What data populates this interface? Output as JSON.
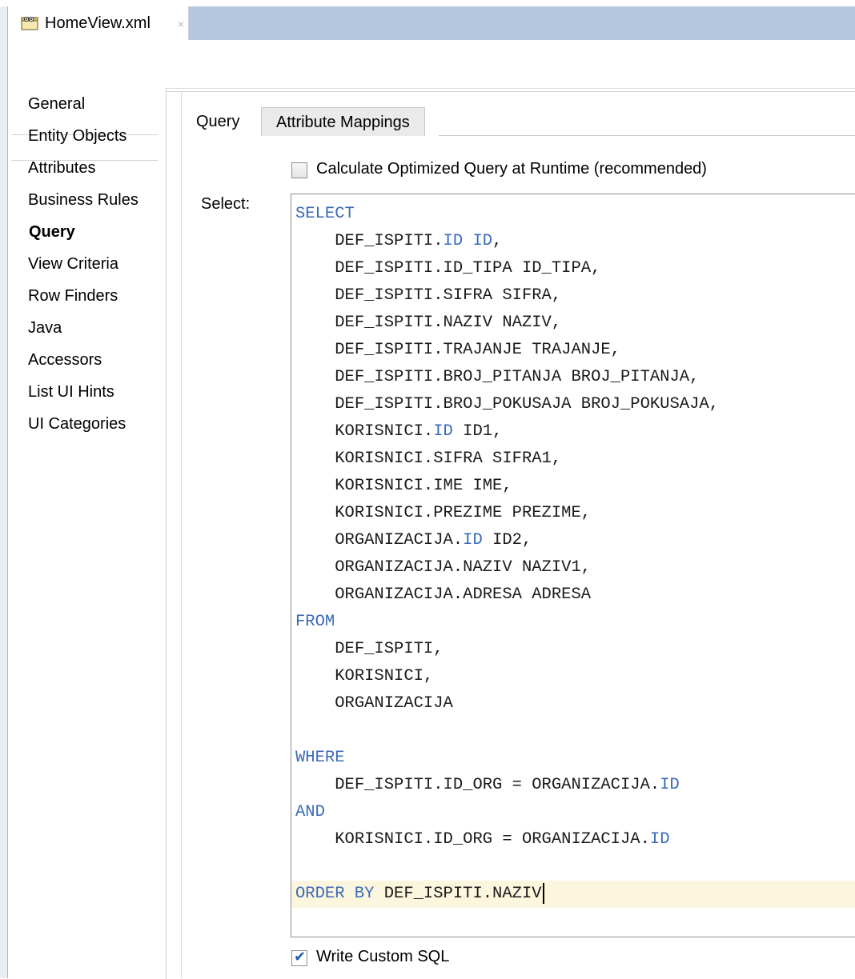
{
  "editor": {
    "file_tab": "HomeView.xml",
    "close_glyph": "×",
    "file_icon": "view-object-icon"
  },
  "sidebar": {
    "items": [
      {
        "label": "General"
      },
      {
        "label": "Entity Objects"
      },
      {
        "label": "Attributes"
      },
      {
        "label": "Business Rules"
      },
      {
        "label": "Query",
        "selected": true
      },
      {
        "label": "View Criteria"
      },
      {
        "label": "Row Finders"
      },
      {
        "label": "Java"
      },
      {
        "label": "Accessors"
      },
      {
        "label": "List UI Hints"
      },
      {
        "label": "UI Categories"
      }
    ]
  },
  "main": {
    "tabs": [
      {
        "label": "Query",
        "active": true
      },
      {
        "label": "Attribute Mappings",
        "active": false
      }
    ],
    "optimize_checkbox": {
      "label": "Calculate Optimized Query at Runtime (recommended)",
      "checked": false
    },
    "select_label": "Select:",
    "custom_sql_checkbox": {
      "label": "Write Custom SQL",
      "checked": true
    },
    "check_glyph": "✔"
  },
  "sql": {
    "lines": [
      {
        "keyword": "SELECT"
      },
      {
        "indent": "    ",
        "parts": [
          "DEF_ISPITI.",
          {
            "kw": "ID"
          },
          " ",
          {
            "kw": "ID"
          },
          ","
        ]
      },
      {
        "indent": "    ",
        "parts": [
          "DEF_ISPITI.ID_TIPA ID_TIPA,"
        ]
      },
      {
        "indent": "    ",
        "parts": [
          "DEF_ISPITI.SIFRA SIFRA,"
        ]
      },
      {
        "indent": "    ",
        "parts": [
          "DEF_ISPITI.NAZIV NAZIV,"
        ]
      },
      {
        "indent": "    ",
        "parts": [
          "DEF_ISPITI.TRAJANJE TRAJANJE,"
        ]
      },
      {
        "indent": "    ",
        "parts": [
          "DEF_ISPITI.BROJ_PITANJA BROJ_PITANJA,"
        ]
      },
      {
        "indent": "    ",
        "parts": [
          "DEF_ISPITI.BROJ_POKUSAJA BROJ_POKUSAJA,"
        ]
      },
      {
        "indent": "    ",
        "parts": [
          "KORISNICI.",
          {
            "kw": "ID"
          },
          " ID1,"
        ]
      },
      {
        "indent": "    ",
        "parts": [
          "KORISNICI.SIFRA SIFRA1,"
        ]
      },
      {
        "indent": "    ",
        "parts": [
          "KORISNICI.IME IME,"
        ]
      },
      {
        "indent": "    ",
        "parts": [
          "KORISNICI.PREZIME PREZIME,"
        ]
      },
      {
        "indent": "    ",
        "parts": [
          "ORGANIZACIJA.",
          {
            "kw": "ID"
          },
          " ID2,"
        ]
      },
      {
        "indent": "    ",
        "parts": [
          "ORGANIZACIJA.NAZIV NAZIV1,"
        ]
      },
      {
        "indent": "    ",
        "parts": [
          "ORGANIZACIJA.ADRESA ADRESA"
        ]
      },
      {
        "keyword": "FROM"
      },
      {
        "indent": "    ",
        "parts": [
          "DEF_ISPITI,"
        ]
      },
      {
        "indent": "    ",
        "parts": [
          "KORISNICI,"
        ]
      },
      {
        "indent": "    ",
        "parts": [
          "ORGANIZACIJA"
        ]
      },
      {
        "blank": true
      },
      {
        "keyword": "WHERE"
      },
      {
        "indent": "    ",
        "parts": [
          "DEF_ISPITI.ID_ORG = ORGANIZACIJA.",
          {
            "kw": "ID"
          }
        ]
      },
      {
        "keyword": "AND"
      },
      {
        "indent": "    ",
        "parts": [
          "KORISNICI.ID_ORG = ORGANIZACIJA.",
          {
            "kw": "ID"
          }
        ]
      },
      {
        "blank": true
      },
      {
        "parts": [
          {
            "kw": "ORDER BY"
          },
          " DEF_ISPITI.NAZIV"
        ],
        "current": true
      }
    ]
  },
  "colors": {
    "tabstrip": "#b6c8df",
    "keyword": "#3a6ab8",
    "current_line": "#fdf6de"
  }
}
